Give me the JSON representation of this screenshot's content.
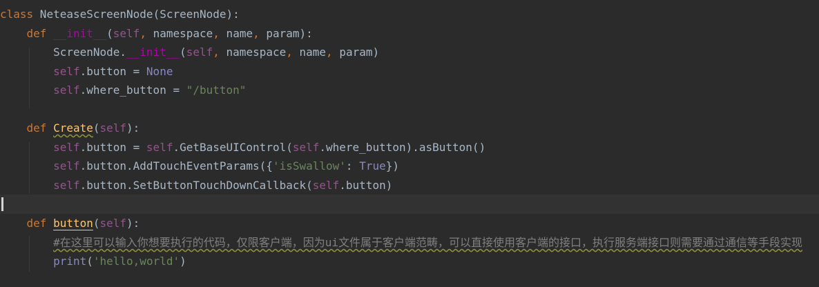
{
  "theme": {
    "background": "#2b2b2b",
    "current_line": "#323232",
    "keyword": "#cc7832",
    "self": "#94558d",
    "magic_method": "#b200b2",
    "string": "#6a8759",
    "function_def": "#ffc66d",
    "builtin_const": "#8888c6",
    "comment": "#808080",
    "text": "#a9b7c6"
  },
  "code": {
    "line1": {
      "kw": "class",
      "name": " NeteaseScreenNode(ScreenNode):"
    },
    "line2": {
      "indent": "    ",
      "kw": "def",
      "sp": " ",
      "fn": "__init__",
      "p1": "(",
      "self": "self",
      "c1": ",",
      "a1": " namespace",
      "c2": ",",
      "a2": " name",
      "c3": ",",
      "a3": " param):"
    },
    "line3": {
      "indent": "        ",
      "a": "ScreenNode.",
      "fn": "__init__",
      "p1": "(",
      "self": "self",
      "c1": ",",
      "a1": " namespace",
      "c2": ",",
      "a2": " name",
      "c3": ",",
      "a3": " param)"
    },
    "line4": {
      "indent": "        ",
      "self": "self",
      "a": ".button = ",
      "const": "None"
    },
    "line5": {
      "indent": "        ",
      "self": "self",
      "a": ".where_button = ",
      "str": "\"/button\""
    },
    "line7": {
      "indent": "    ",
      "kw": "def",
      "sp": " ",
      "fn": "Create",
      "p1": "(",
      "self": "self",
      "p2": "):"
    },
    "line8": {
      "indent": "        ",
      "self1": "self",
      "a": ".button = ",
      "self2": "self",
      "b": ".GetBaseUIControl(",
      "self3": "self",
      "c": ".where_button).asButton()"
    },
    "line9": {
      "indent": "        ",
      "self": "self",
      "a": ".button.AddTouchEventParams({",
      "str": "'isSwallow'",
      "b": ": ",
      "const": "True",
      "c": "})"
    },
    "line10": {
      "indent": "        ",
      "self1": "self",
      "a": ".button.SetButtonTouchDownCallback(",
      "self2": "self",
      "b": ".button)"
    },
    "line12": {
      "indent": "    ",
      "kw": "def",
      "sp": " ",
      "fn": "button",
      "p1": "(",
      "self": "self",
      "p2": "):"
    },
    "line13": {
      "indent": "        ",
      "cmt": "#在这里可以输入你想要执行的代码，仅限客户端，因为ui文件属于客户端范畴，可以直接使用客户端的接口，执行服务端接口则需要通过通信等手段实现"
    },
    "line14": {
      "indent": "        ",
      "fn": "print",
      "p1": "(",
      "str": "'hello,world'",
      "p2": ")"
    }
  }
}
